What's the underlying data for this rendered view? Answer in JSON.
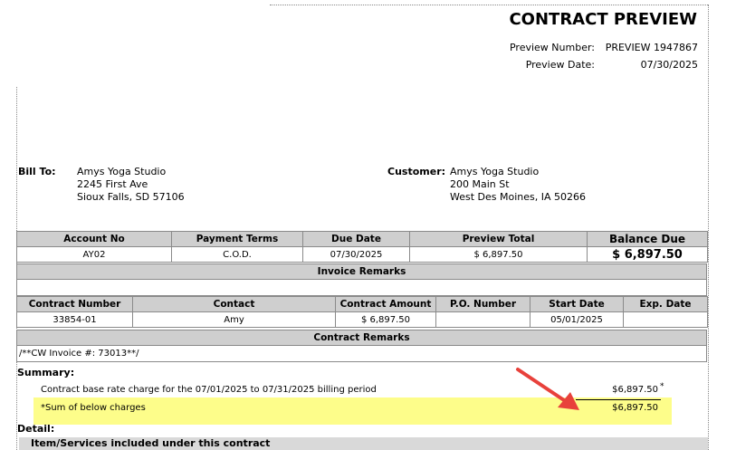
{
  "header": {
    "title": "CONTRACT PREVIEW",
    "preview_number_label": "Preview Number:",
    "preview_number": "PREVIEW 1947867",
    "preview_date_label": "Preview Date:",
    "preview_date": "07/30/2025"
  },
  "bill_to": {
    "label": "Bill To:",
    "name": "Amys Yoga Studio",
    "street": "2245 First Ave",
    "city_line": "Sioux Falls,  SD  57106"
  },
  "customer": {
    "label": "Customer:",
    "name": "Amys Yoga Studio",
    "street": "200 Main St",
    "city_line": "West Des Moines,  IA  50266"
  },
  "account_table": {
    "headers": [
      "Account No",
      "Payment Terms",
      "Due Date",
      "Preview Total",
      "Balance Due"
    ],
    "values": [
      "AY02",
      "C.O.D.",
      "07/30/2025",
      "$ 6,897.50",
      "$  6,897.50"
    ]
  },
  "invoice_remarks": {
    "header": "Invoice Remarks",
    "text": ""
  },
  "contract_table": {
    "headers": [
      "Contract Number",
      "Contact",
      "Contract Amount",
      "P.O. Number",
      "Start Date",
      "Exp. Date"
    ],
    "values": [
      "33854-01",
      "Amy",
      "$ 6,897.50",
      "",
      "05/01/2025",
      ""
    ]
  },
  "contract_remarks": {
    "header": "Contract Remarks",
    "text": "/**CW Invoice #: 73013**/"
  },
  "summary": {
    "label": "Summary:",
    "line_desc": "Contract base rate charge for the 07/01/2025 to 07/31/2025 billing period",
    "line_amount": "$6,897.50",
    "asterisk": "*",
    "sum_desc": "*Sum of below charges",
    "sum_amount": "$6,897.50"
  },
  "detail": {
    "label": "Detail:",
    "bar_text": "Item/Services included under this contract"
  },
  "colors": {
    "highlight": "#fdfd8a",
    "header_gray": "#cfcfcf",
    "arrow": "#e8413b"
  }
}
